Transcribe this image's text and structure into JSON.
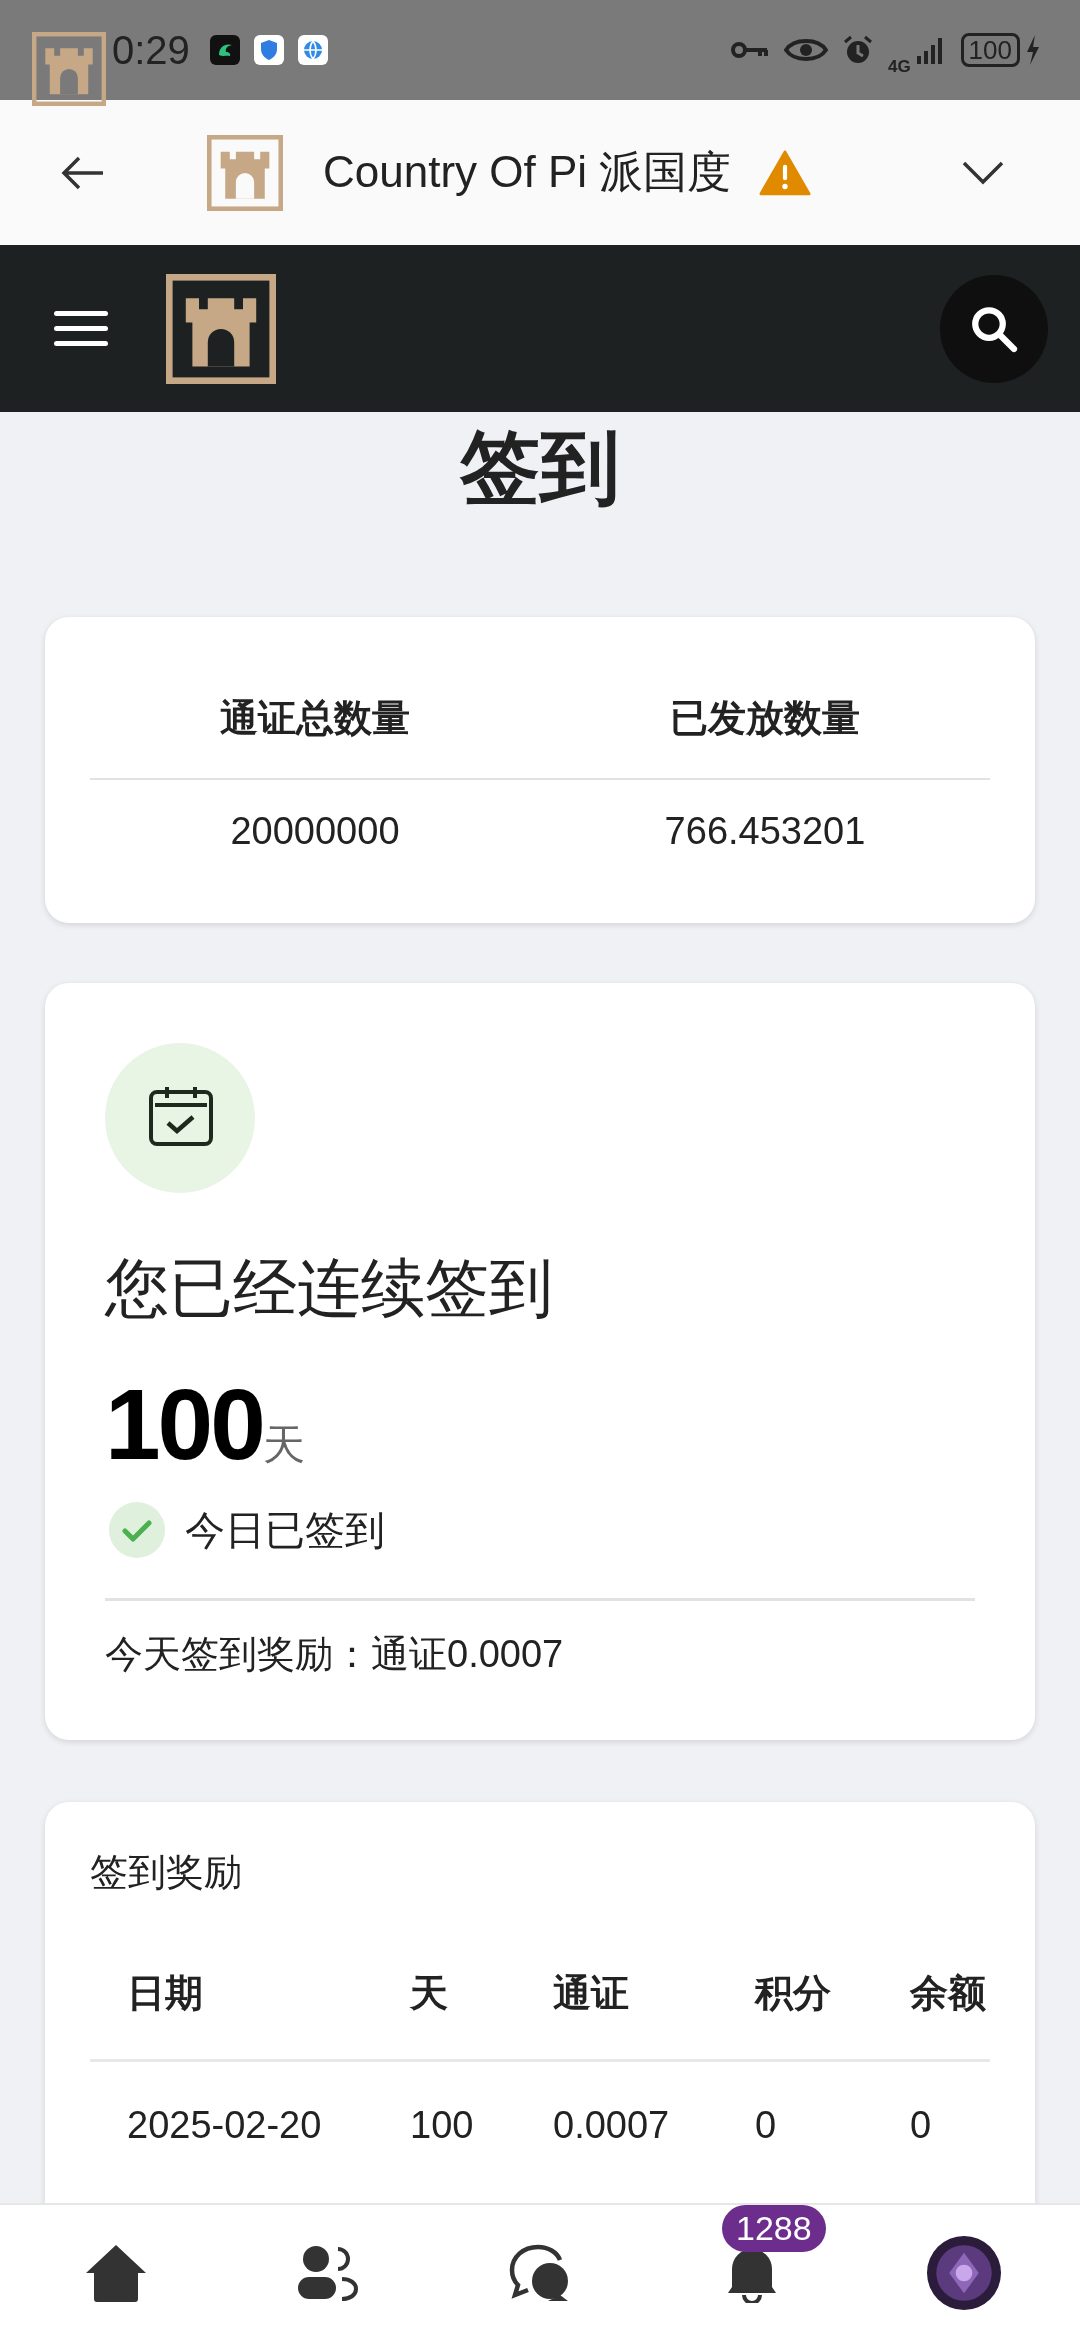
{
  "status_bar": {
    "time": "0:29",
    "network": "4G",
    "battery": "100"
  },
  "app_bar": {
    "title": "Country Of Pi 派国度",
    "warning": true
  },
  "page_title": "签到",
  "token_stats": {
    "columns": [
      "通证总数量",
      "已发放数量"
    ],
    "values": [
      "20000000",
      "766.453201"
    ]
  },
  "checkin": {
    "heading": "您已经连续签到",
    "days": "100",
    "unit": "天",
    "checked_today": true,
    "status": "今日已签到",
    "reward": "今天签到奖励：通证0.0007"
  },
  "rewards": {
    "title": "签到奖励",
    "columns": [
      "日期",
      "天",
      "通证",
      "积分",
      "余额"
    ],
    "rows": [
      [
        "2025-02-20",
        "100",
        "0.0007",
        "0",
        "0"
      ]
    ]
  },
  "bottom_nav": {
    "items": [
      {
        "kind": "home"
      },
      {
        "kind": "friends"
      },
      {
        "kind": "chat"
      },
      {
        "kind": "bell",
        "badge": "1288"
      },
      {
        "kind": "avatar"
      }
    ]
  }
}
